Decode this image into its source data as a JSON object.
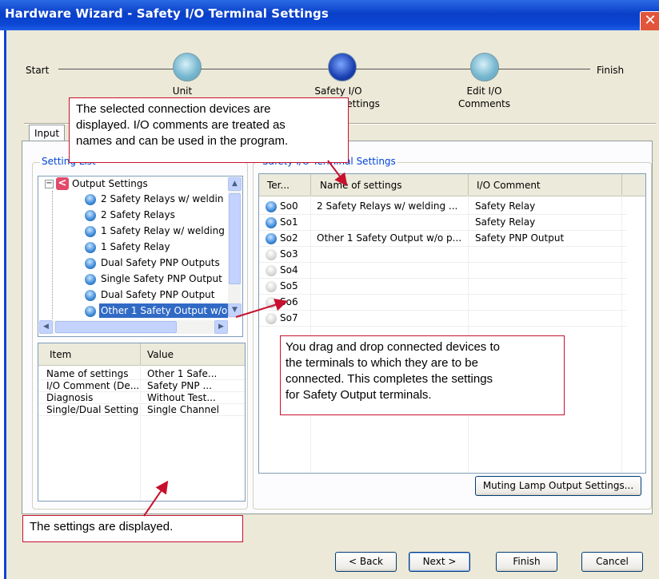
{
  "window": {
    "title": "Hardware Wizard - Safety I/O Terminal Settings",
    "close_glyph": "✕"
  },
  "steps": [
    {
      "label": "Start"
    },
    {
      "label": "Unit"
    },
    {
      "label": "Safety I/O",
      "label2": "Terminal Settings"
    },
    {
      "label": "Edit I/O",
      "label2": "Comments"
    },
    {
      "label": "Finish"
    }
  ],
  "tabs": {
    "input": "Input"
  },
  "setting_list": {
    "title": "Setting List",
    "root": "Output Settings",
    "items": [
      "2 Safety Relays w/ weldin",
      "2 Safety Relays",
      "1 Safety Relay w/ welding",
      "1 Safety Relay",
      "Dual Safety PNP Outputs",
      "Single Safety PNP Output",
      "Dual Safety PNP Output",
      "Other 1 Safety Output w/o"
    ],
    "selected_index": 7
  },
  "properties": {
    "headers": {
      "item": "Item",
      "value": "Value"
    },
    "rows": [
      {
        "item": "Name of settings",
        "value": "Other 1 Safe..."
      },
      {
        "item": "I/O Comment (De...",
        "value": "Safety PNP ..."
      },
      {
        "item": "Diagnosis",
        "value": "Without Test..."
      },
      {
        "item": "Single/Dual Setting",
        "value": "Single Channel"
      }
    ]
  },
  "terminal_settings": {
    "title": "Safety I/O Terminal Settings",
    "headers": {
      "terminal": "Ter...",
      "name": "Name of settings",
      "comment": "I/O Comment"
    },
    "rows": [
      {
        "terminal": "So0",
        "name": "2 Safety Relays w/ welding ...",
        "comment": "Safety Relay",
        "assigned": true
      },
      {
        "terminal": "So1",
        "name": "",
        "comment": "Safety Relay",
        "assigned": true
      },
      {
        "terminal": "So2",
        "name": "Other 1 Safety Output w/o p...",
        "comment": "Safety PNP Output",
        "assigned": true
      },
      {
        "terminal": "So3",
        "name": "",
        "comment": "",
        "assigned": false
      },
      {
        "terminal": "So4",
        "name": "",
        "comment": "",
        "assigned": false
      },
      {
        "terminal": "So5",
        "name": "",
        "comment": "",
        "assigned": false
      },
      {
        "terminal": "So6",
        "name": "",
        "comment": "",
        "assigned": false
      },
      {
        "terminal": "So7",
        "name": "",
        "comment": "",
        "assigned": false
      }
    ],
    "muting_button": "Muting Lamp Output Settings..."
  },
  "footer": {
    "back": "< Back",
    "next": "Next >",
    "finish": "Finish",
    "cancel": "Cancel"
  },
  "callouts": {
    "top": [
      "The selected connection devices are",
      "displayed. I/O comments are treated as",
      "names and can be used in the program."
    ],
    "middle": [
      "You drag and drop connected devices to",
      "the terminals to which they are to be",
      "connected. This completes the settings",
      "for Safety Output terminals."
    ],
    "bottom": "The settings are displayed."
  },
  "colors": {
    "titlebar": "#0b46d4",
    "selection": "#316ac5",
    "callout_border": "#c8102e"
  }
}
